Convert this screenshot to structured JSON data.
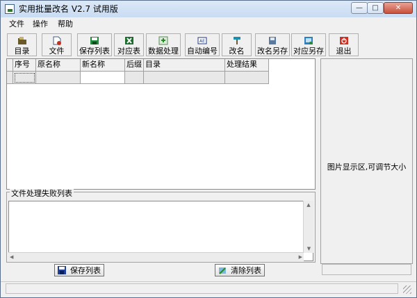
{
  "window": {
    "title": "实用批量改名 V2.7 试用版",
    "minimize_glyph": "—",
    "maximize_glyph": "□",
    "close_glyph": "✕"
  },
  "menu": [
    "文件",
    "操作",
    "帮助"
  ],
  "toolbar": {
    "items": [
      {
        "label": "目录",
        "icon": "folder-icon"
      },
      {
        "label": "文件",
        "icon": "file-icon"
      },
      {
        "label": "保存列表",
        "icon": "save-icon"
      },
      {
        "label": "对应表",
        "icon": "excel-icon"
      },
      {
        "label": "数据处理",
        "icon": "data-process-icon"
      },
      {
        "label": "自动编号",
        "icon": "auto-number-icon"
      },
      {
        "label": "改名",
        "icon": "hammer-icon"
      },
      {
        "label": "改名另存",
        "icon": "rename-save-as-icon"
      },
      {
        "label": "对应另存",
        "icon": "map-save-as-icon"
      },
      {
        "label": "退出",
        "icon": "power-icon"
      }
    ]
  },
  "grid": {
    "columns": [
      "序号",
      "原名称",
      "新名称",
      "后缀",
      "目录",
      "处理结果"
    ]
  },
  "failed_list": {
    "title": "文件处理失败列表",
    "save_button": "保存列表",
    "clear_button": "清除列表"
  },
  "image_panel": {
    "text": "图片显示区,可调节大小"
  },
  "colors": {
    "titlebar": "#c9dcf2",
    "close_button": "#c8503c",
    "panel": "#f0f0f0"
  }
}
